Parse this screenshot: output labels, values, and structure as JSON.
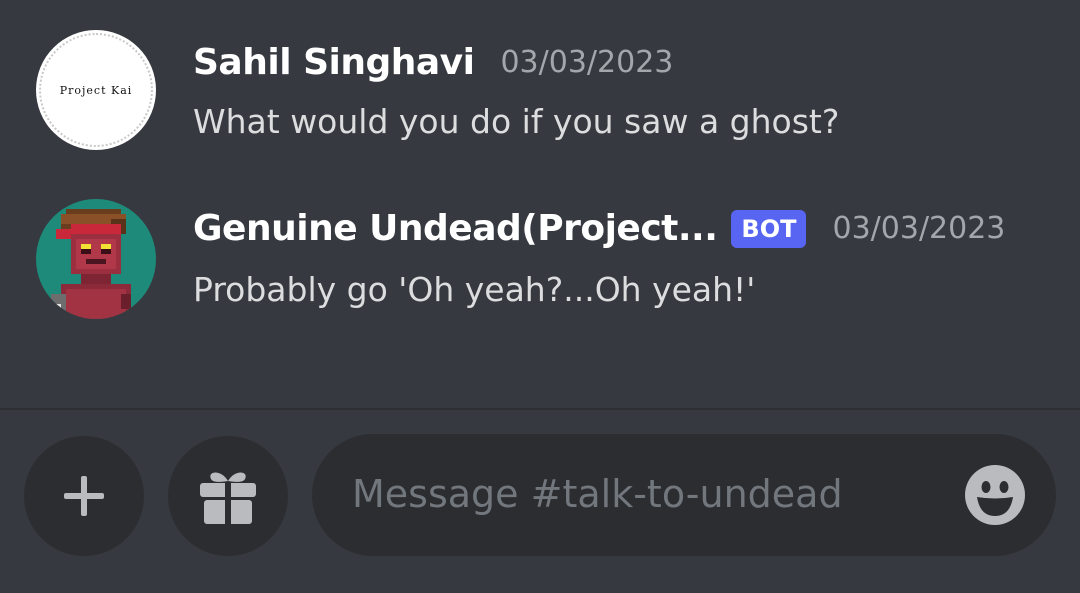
{
  "messages": [
    {
      "username": "Sahil Singhavi",
      "timestamp": "03/03/2023",
      "text": "What would you do if you saw a ghost?",
      "avatar": {
        "type": "logo",
        "logo_text": "Project Kai",
        "icon": "project-kai-logo-avatar"
      }
    },
    {
      "username": "Genuine Undead(Project...",
      "badge": "BOT",
      "timestamp": "03/03/2023",
      "text": "Probably go 'Oh yeah?...Oh yeah!'",
      "avatar": {
        "type": "pixel-art",
        "icon": "undead-pixel-avatar"
      }
    }
  ],
  "composer": {
    "add_icon": "plus-icon",
    "gift_icon": "gift-icon",
    "placeholder": "Message #talk-to-undead",
    "emoji_icon": "smiley-emoji-icon"
  },
  "colors": {
    "background": "#36393f",
    "input_background": "#2b2d31",
    "bot_badge": "#5865f2",
    "username": "#ffffff",
    "timestamp": "#a3a6aa",
    "message_text": "#dcddde",
    "placeholder": "#72767d"
  }
}
